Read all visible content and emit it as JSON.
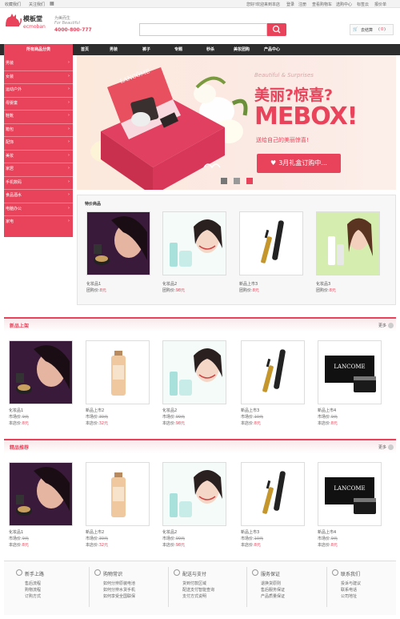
{
  "topbar": {
    "fav": "收藏我们",
    "follow": "关注我们",
    "welcome": "您好!欢迎来到本店",
    "login": "登录",
    "register": "注册",
    "links": [
      "查看购物车",
      "选购中心",
      "标签云",
      "报价单"
    ]
  },
  "header": {
    "logo_cn": "模板堂",
    "logo_en": "ecmoban",
    "slogan": "为美而生",
    "slogan_en": "For Beautiful",
    "phone": "4000-800-777",
    "search_placeholder": "",
    "cart_label": "去结算",
    "cart_count": "0"
  },
  "nav": {
    "category_label": "所有商品分类",
    "items": [
      "首页",
      "男装",
      "裤子",
      "专题",
      "秒杀",
      "美妆团购",
      "产品中心"
    ]
  },
  "sidebar": {
    "items": [
      "男装",
      "女装",
      "运动户外",
      "母婴童",
      "鞋靴",
      "箱包",
      "配饰",
      "美妆",
      "家居",
      "手机数码",
      "食品酒水",
      "电脑办公",
      "家电"
    ]
  },
  "banner": {
    "subtitle": "Beautiful & Surprises",
    "title": "美丽?惊喜?",
    "brand": "MEBOX!",
    "tagline": "送给自己的美丽惊喜!",
    "button": "3月礼盒订购中...",
    "box_brand": "LANCÔME"
  },
  "special": {
    "title": "特价商品",
    "items": [
      {
        "name": "化妆品1",
        "price_label": "团购价:",
        "price": "8元"
      },
      {
        "name": "化妆品2",
        "price_label": "团购价:",
        "price": "98元"
      },
      {
        "name": "新品上市3",
        "price_label": "团购价:",
        "price": "8元"
      },
      {
        "name": "化妆品3",
        "price_label": "团购价:",
        "price": "8元"
      }
    ]
  },
  "new_arrivals": {
    "title": "新品上架",
    "more": "更多",
    "items": [
      {
        "name": "化妆品1",
        "market_label": "市场价:",
        "market": "9元",
        "shop_label": "本店价:",
        "shop": "8元"
      },
      {
        "name": "新品上市2",
        "market_label": "市场价:",
        "market": "39元",
        "shop_label": "本店价:",
        "shop": "32元"
      },
      {
        "name": "化妆品2",
        "market_label": "市场价:",
        "market": "99元",
        "shop_label": "本店价:",
        "shop": "98元"
      },
      {
        "name": "新品上市3",
        "market_label": "市场价:",
        "market": "10元",
        "shop_label": "本店价:",
        "shop": "8元"
      },
      {
        "name": "新品上市4",
        "market_label": "市场价:",
        "market": "9元",
        "shop_label": "本店价:",
        "shop": "8元"
      }
    ]
  },
  "recommended": {
    "title": "精品推荐",
    "more": "更多",
    "items": [
      {
        "name": "化妆品1",
        "market_label": "市场价:",
        "market": "9元",
        "shop_label": "本店价:",
        "shop": "8元"
      },
      {
        "name": "新品上市2",
        "market_label": "市场价:",
        "market": "39元",
        "shop_label": "本店价:",
        "shop": "32元"
      },
      {
        "name": "化妆品2",
        "market_label": "市场价:",
        "market": "99元",
        "shop_label": "本店价:",
        "shop": "98元"
      },
      {
        "name": "新品上市3",
        "market_label": "市场价:",
        "market": "10元",
        "shop_label": "本店价:",
        "shop": "8元"
      },
      {
        "name": "新品上市4",
        "market_label": "市场价:",
        "market": "9元",
        "shop_label": "本店价:",
        "shop": "8元"
      }
    ]
  },
  "footer": {
    "columns": [
      {
        "title": "新手上路",
        "links": [
          "售后流程",
          "购物流程",
          "订购方式"
        ]
      },
      {
        "title": "购物常识",
        "links": [
          "如何分辨原装电池",
          "如何分辨水货手机",
          "如何享受全国联保"
        ]
      },
      {
        "title": "配送与支付",
        "links": [
          "货到付款区域",
          "配送支付智能查询",
          "支付方式说明"
        ]
      },
      {
        "title": "服务保证",
        "links": [
          "退换货原则",
          "售后服务保证",
          "产品质量保证"
        ]
      },
      {
        "title": "联系我们",
        "links": [
          "投诉与建议",
          "联系电话",
          "公司地址"
        ]
      }
    ]
  },
  "colors": {
    "accent": "#e8435a",
    "nav_bg": "#2d2d2d"
  }
}
